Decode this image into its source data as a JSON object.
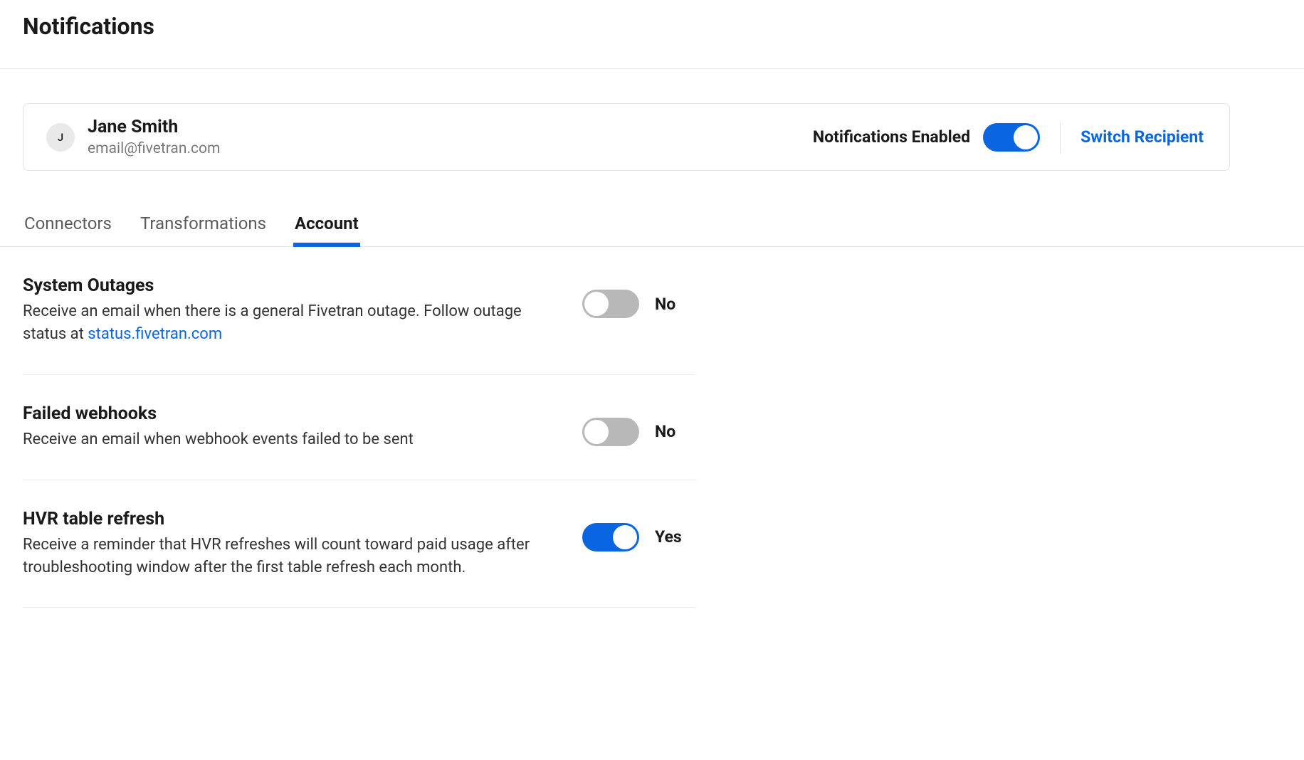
{
  "header": {
    "title": "Notifications"
  },
  "recipient": {
    "avatar_initial": "J",
    "name": "Jane Smith",
    "email": "email@fivetran.com",
    "enabled_label": "Notifications Enabled",
    "switch_link": "Switch Recipient"
  },
  "tabs": [
    {
      "label": "Connectors"
    },
    {
      "label": "Transformations"
    },
    {
      "label": "Account"
    }
  ],
  "active_tab": 2,
  "toggle_text": {
    "yes": "Yes",
    "no": "No"
  },
  "settings": [
    {
      "title": "System Outages",
      "desc_pre": "Receive an email when there is a general Fivetran outage. Follow outage status at ",
      "link_text": "status.fivetran.com",
      "on": false
    },
    {
      "title": "Failed webhooks",
      "desc_pre": "Receive an email when webhook events failed to be sent",
      "link_text": "",
      "on": false
    },
    {
      "title": "HVR table refresh",
      "desc_pre": "Receive a reminder that HVR refreshes will count toward paid usage after troubleshooting window after the first table refresh each month.",
      "link_text": "",
      "on": true
    }
  ]
}
